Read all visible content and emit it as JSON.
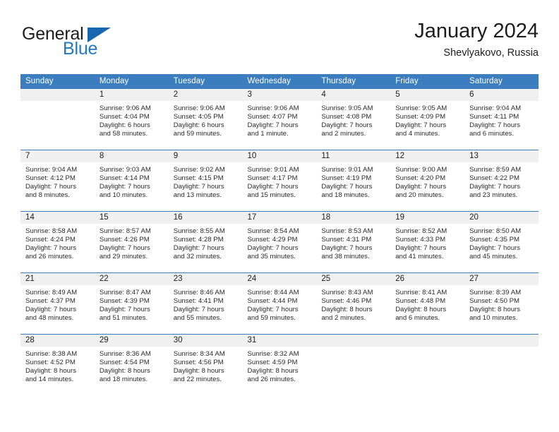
{
  "brand": {
    "name_part1": "General",
    "name_part2": "Blue",
    "logo_icon": "triangle-icon"
  },
  "header": {
    "title": "January 2024",
    "location": "Shevlyakovo, Russia"
  },
  "colors": {
    "header_blue": "#3a7ebf",
    "brand_blue": "#2079c4",
    "daynum_bg": "#f0f0f0",
    "text": "#1d1d1d"
  },
  "calendar": {
    "weekdays": [
      "Sunday",
      "Monday",
      "Tuesday",
      "Wednesday",
      "Thursday",
      "Friday",
      "Saturday"
    ],
    "weeks": [
      [
        {
          "day": "",
          "sunrise": "",
          "sunset": "",
          "daylight1": "",
          "daylight2": ""
        },
        {
          "day": "1",
          "sunrise": "Sunrise: 9:06 AM",
          "sunset": "Sunset: 4:04 PM",
          "daylight1": "Daylight: 6 hours",
          "daylight2": "and 58 minutes."
        },
        {
          "day": "2",
          "sunrise": "Sunrise: 9:06 AM",
          "sunset": "Sunset: 4:05 PM",
          "daylight1": "Daylight: 6 hours",
          "daylight2": "and 59 minutes."
        },
        {
          "day": "3",
          "sunrise": "Sunrise: 9:06 AM",
          "sunset": "Sunset: 4:07 PM",
          "daylight1": "Daylight: 7 hours",
          "daylight2": "and 1 minute."
        },
        {
          "day": "4",
          "sunrise": "Sunrise: 9:05 AM",
          "sunset": "Sunset: 4:08 PM",
          "daylight1": "Daylight: 7 hours",
          "daylight2": "and 2 minutes."
        },
        {
          "day": "5",
          "sunrise": "Sunrise: 9:05 AM",
          "sunset": "Sunset: 4:09 PM",
          "daylight1": "Daylight: 7 hours",
          "daylight2": "and 4 minutes."
        },
        {
          "day": "6",
          "sunrise": "Sunrise: 9:04 AM",
          "sunset": "Sunset: 4:11 PM",
          "daylight1": "Daylight: 7 hours",
          "daylight2": "and 6 minutes."
        }
      ],
      [
        {
          "day": "7",
          "sunrise": "Sunrise: 9:04 AM",
          "sunset": "Sunset: 4:12 PM",
          "daylight1": "Daylight: 7 hours",
          "daylight2": "and 8 minutes."
        },
        {
          "day": "8",
          "sunrise": "Sunrise: 9:03 AM",
          "sunset": "Sunset: 4:14 PM",
          "daylight1": "Daylight: 7 hours",
          "daylight2": "and 10 minutes."
        },
        {
          "day": "9",
          "sunrise": "Sunrise: 9:02 AM",
          "sunset": "Sunset: 4:15 PM",
          "daylight1": "Daylight: 7 hours",
          "daylight2": "and 13 minutes."
        },
        {
          "day": "10",
          "sunrise": "Sunrise: 9:01 AM",
          "sunset": "Sunset: 4:17 PM",
          "daylight1": "Daylight: 7 hours",
          "daylight2": "and 15 minutes."
        },
        {
          "day": "11",
          "sunrise": "Sunrise: 9:01 AM",
          "sunset": "Sunset: 4:19 PM",
          "daylight1": "Daylight: 7 hours",
          "daylight2": "and 18 minutes."
        },
        {
          "day": "12",
          "sunrise": "Sunrise: 9:00 AM",
          "sunset": "Sunset: 4:20 PM",
          "daylight1": "Daylight: 7 hours",
          "daylight2": "and 20 minutes."
        },
        {
          "day": "13",
          "sunrise": "Sunrise: 8:59 AM",
          "sunset": "Sunset: 4:22 PM",
          "daylight1": "Daylight: 7 hours",
          "daylight2": "and 23 minutes."
        }
      ],
      [
        {
          "day": "14",
          "sunrise": "Sunrise: 8:58 AM",
          "sunset": "Sunset: 4:24 PM",
          "daylight1": "Daylight: 7 hours",
          "daylight2": "and 26 minutes."
        },
        {
          "day": "15",
          "sunrise": "Sunrise: 8:57 AM",
          "sunset": "Sunset: 4:26 PM",
          "daylight1": "Daylight: 7 hours",
          "daylight2": "and 29 minutes."
        },
        {
          "day": "16",
          "sunrise": "Sunrise: 8:55 AM",
          "sunset": "Sunset: 4:28 PM",
          "daylight1": "Daylight: 7 hours",
          "daylight2": "and 32 minutes."
        },
        {
          "day": "17",
          "sunrise": "Sunrise: 8:54 AM",
          "sunset": "Sunset: 4:29 PM",
          "daylight1": "Daylight: 7 hours",
          "daylight2": "and 35 minutes."
        },
        {
          "day": "18",
          "sunrise": "Sunrise: 8:53 AM",
          "sunset": "Sunset: 4:31 PM",
          "daylight1": "Daylight: 7 hours",
          "daylight2": "and 38 minutes."
        },
        {
          "day": "19",
          "sunrise": "Sunrise: 8:52 AM",
          "sunset": "Sunset: 4:33 PM",
          "daylight1": "Daylight: 7 hours",
          "daylight2": "and 41 minutes."
        },
        {
          "day": "20",
          "sunrise": "Sunrise: 8:50 AM",
          "sunset": "Sunset: 4:35 PM",
          "daylight1": "Daylight: 7 hours",
          "daylight2": "and 45 minutes."
        }
      ],
      [
        {
          "day": "21",
          "sunrise": "Sunrise: 8:49 AM",
          "sunset": "Sunset: 4:37 PM",
          "daylight1": "Daylight: 7 hours",
          "daylight2": "and 48 minutes."
        },
        {
          "day": "22",
          "sunrise": "Sunrise: 8:47 AM",
          "sunset": "Sunset: 4:39 PM",
          "daylight1": "Daylight: 7 hours",
          "daylight2": "and 51 minutes."
        },
        {
          "day": "23",
          "sunrise": "Sunrise: 8:46 AM",
          "sunset": "Sunset: 4:41 PM",
          "daylight1": "Daylight: 7 hours",
          "daylight2": "and 55 minutes."
        },
        {
          "day": "24",
          "sunrise": "Sunrise: 8:44 AM",
          "sunset": "Sunset: 4:44 PM",
          "daylight1": "Daylight: 7 hours",
          "daylight2": "and 59 minutes."
        },
        {
          "day": "25",
          "sunrise": "Sunrise: 8:43 AM",
          "sunset": "Sunset: 4:46 PM",
          "daylight1": "Daylight: 8 hours",
          "daylight2": "and 2 minutes."
        },
        {
          "day": "26",
          "sunrise": "Sunrise: 8:41 AM",
          "sunset": "Sunset: 4:48 PM",
          "daylight1": "Daylight: 8 hours",
          "daylight2": "and 6 minutes."
        },
        {
          "day": "27",
          "sunrise": "Sunrise: 8:39 AM",
          "sunset": "Sunset: 4:50 PM",
          "daylight1": "Daylight: 8 hours",
          "daylight2": "and 10 minutes."
        }
      ],
      [
        {
          "day": "28",
          "sunrise": "Sunrise: 8:38 AM",
          "sunset": "Sunset: 4:52 PM",
          "daylight1": "Daylight: 8 hours",
          "daylight2": "and 14 minutes."
        },
        {
          "day": "29",
          "sunrise": "Sunrise: 8:36 AM",
          "sunset": "Sunset: 4:54 PM",
          "daylight1": "Daylight: 8 hours",
          "daylight2": "and 18 minutes."
        },
        {
          "day": "30",
          "sunrise": "Sunrise: 8:34 AM",
          "sunset": "Sunset: 4:56 PM",
          "daylight1": "Daylight: 8 hours",
          "daylight2": "and 22 minutes."
        },
        {
          "day": "31",
          "sunrise": "Sunrise: 8:32 AM",
          "sunset": "Sunset: 4:59 PM",
          "daylight1": "Daylight: 8 hours",
          "daylight2": "and 26 minutes."
        },
        {
          "day": "",
          "sunrise": "",
          "sunset": "",
          "daylight1": "",
          "daylight2": ""
        },
        {
          "day": "",
          "sunrise": "",
          "sunset": "",
          "daylight1": "",
          "daylight2": ""
        },
        {
          "day": "",
          "sunrise": "",
          "sunset": "",
          "daylight1": "",
          "daylight2": ""
        }
      ]
    ]
  }
}
